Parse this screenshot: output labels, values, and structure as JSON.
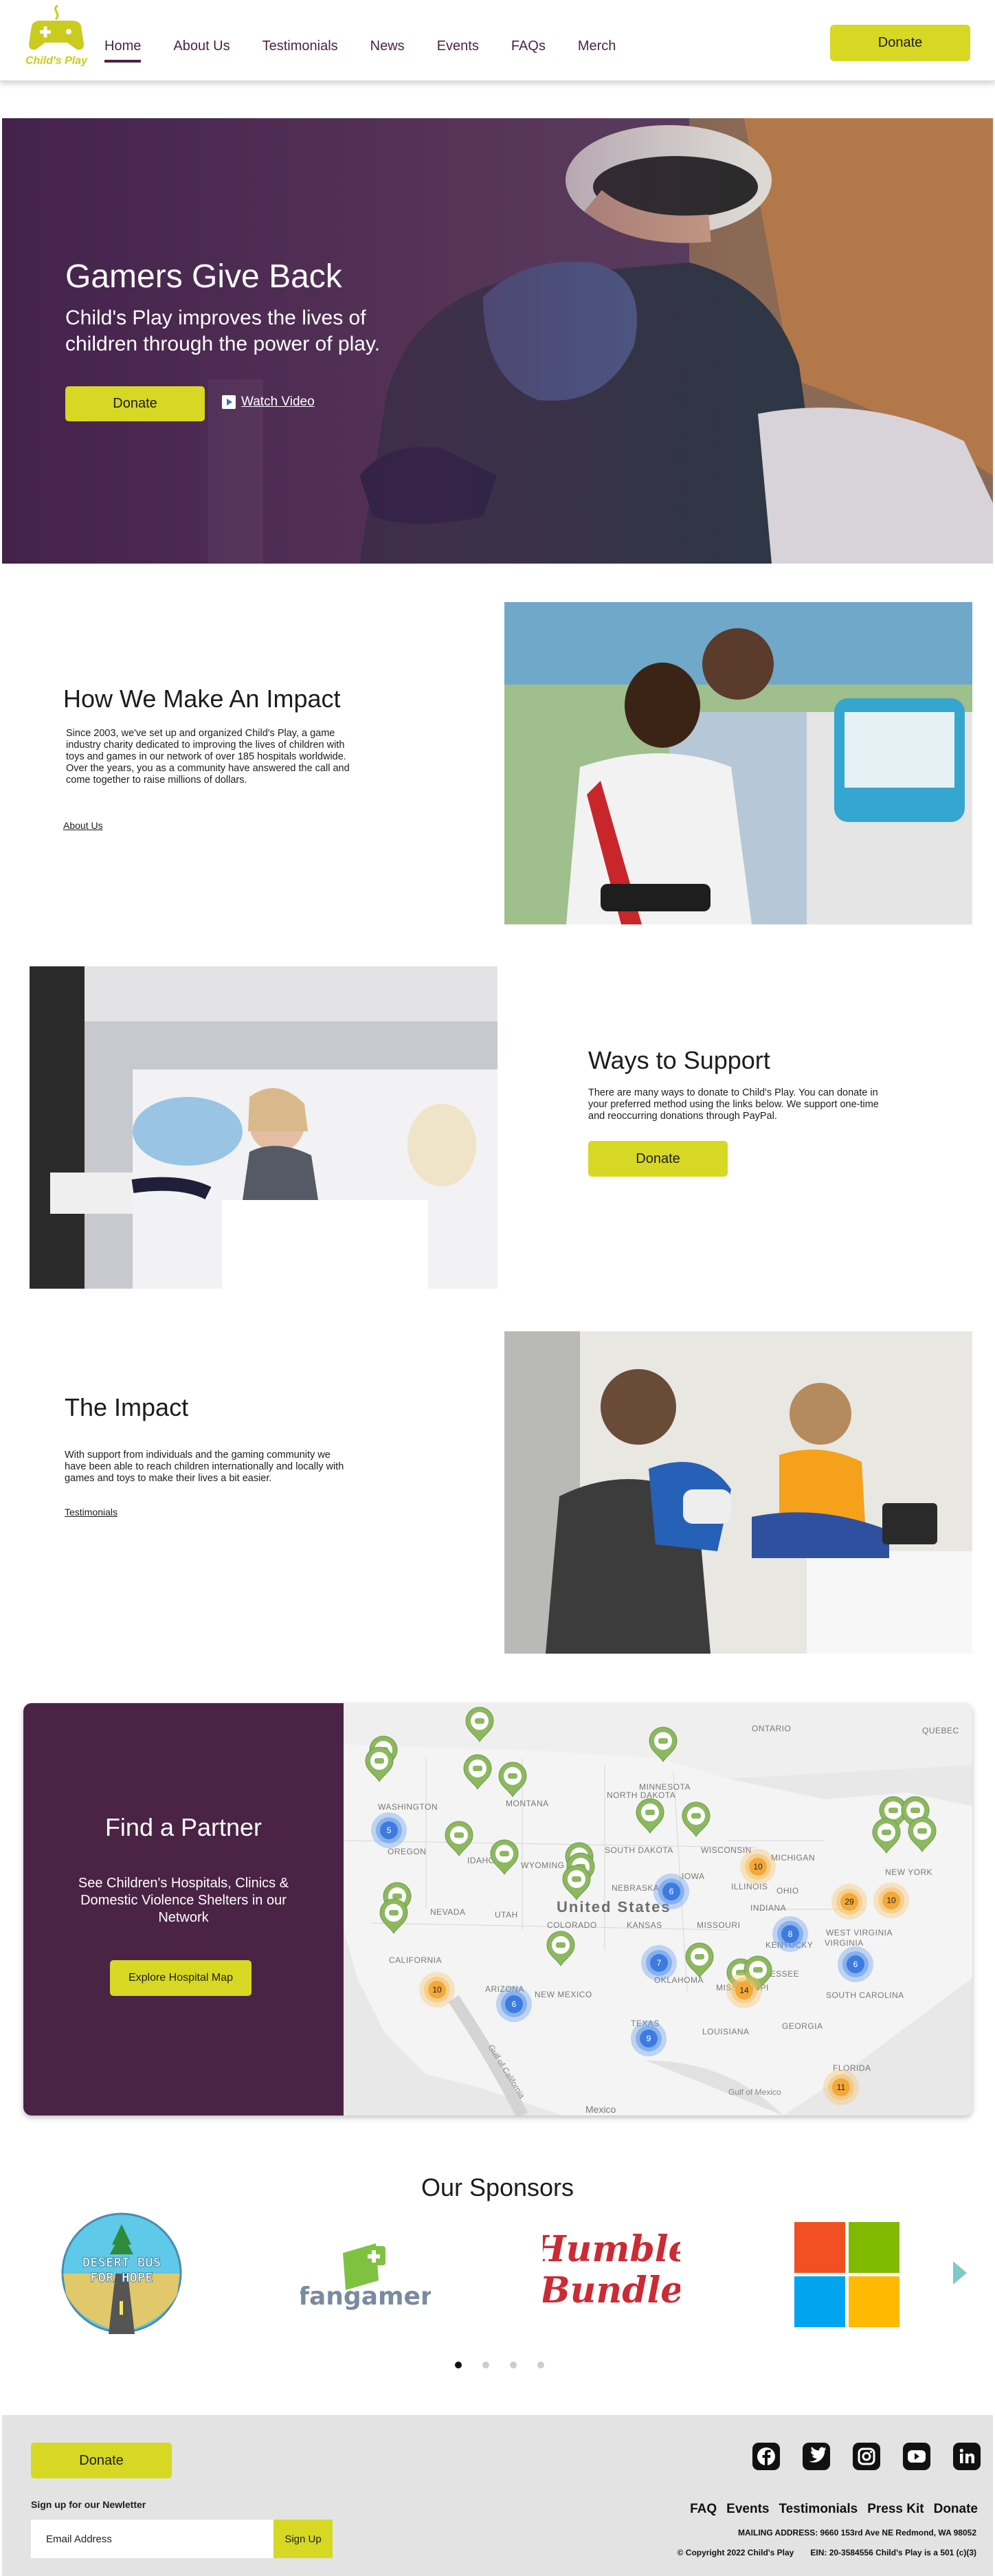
{
  "nav": {
    "logo_text": "Child's Play",
    "links": [
      "Home",
      "About Us",
      "Testimonials",
      "News",
      "Events",
      "FAQs",
      "Merch"
    ],
    "active": "Home",
    "donate_label": "Donate"
  },
  "hero": {
    "title": "Gamers Give Back",
    "subtitle": "Child's Play improves the lives of children through the power of play.",
    "donate_label": "Donate",
    "watch_label": "Watch Video"
  },
  "impact_intro": {
    "title": "How We Make An Impact",
    "body": "Since 2003, we've set up and organized Child's Play, a game industry charity dedicated to improving the lives of children with toys and games in our network of over 185 hospitals worldwide. Over the years, you as a community have answered the call and come together to raise millions of dollars.",
    "link": "About Us"
  },
  "support": {
    "title": "Ways to Support",
    "body": "There are many ways to donate to Child's Play. You can donate in your preferred method using the links below. We support one-time and reoccurring donations through PayPal.",
    "button": "Donate"
  },
  "the_impact": {
    "title": "The Impact",
    "body": "With support from individuals and the gaming community we have been able to reach children internationally and locally with games and toys to make their lives a bit easier.",
    "link": "Testimonials"
  },
  "partner": {
    "title": "Find a Partner",
    "subtitle": "See Children's Hospitals, Clinics & Domestic Violence Shelters in our Network",
    "button": "Explore Hospital Map",
    "map_labels": {
      "country": "United States",
      "mexico": "Mexico",
      "gulf_ca": "Gulf of California",
      "gulf_mx": "Gulf of Mexico",
      "states": [
        "WASHINGTON",
        "OREGON",
        "IDAHO",
        "MONTANA",
        "WYOMING",
        "NEVADA",
        "CALIFORNIA",
        "UTAH",
        "ARIZONA",
        "NEW MEXICO",
        "COLORADO",
        "NORTH DAKOTA",
        "SOUTH DAKOTA",
        "NEBRASKA",
        "KANSAS",
        "OKLAHOMA",
        "TEXAS",
        "MINNESOTA",
        "IOWA",
        "MISSOURI",
        "WISCONSIN",
        "ILLINOIS",
        "MICHIGAN",
        "INDIANA",
        "OHIO",
        "KENTUCKY",
        "TENNESSEE",
        "MISSISSIPPI",
        "LOUISIANA",
        "GEORGIA",
        "FLORIDA",
        "WEST VIRGINIA",
        "VIRGINIA",
        "SOUTH CAROLINA",
        "ONTARIO",
        "QUEBEC",
        "NEW YORK"
      ],
      "clusters_blue": [
        "5",
        "6",
        "7",
        "6",
        "9",
        "8",
        "6"
      ],
      "clusters_orange": [
        "10",
        "10",
        "14",
        "29",
        "10",
        "11"
      ]
    }
  },
  "sponsors": {
    "title": "Our Sponsors",
    "items": [
      {
        "name": "Desert Bus For Hope",
        "line1": "DESERT BUS",
        "line2": "FOR HOPE"
      },
      {
        "name": "Fangamer",
        "text": "fangamer"
      },
      {
        "name": "Humble Bundle",
        "line1": "Humble",
        "line2": "Bundle"
      },
      {
        "name": "Microsoft"
      }
    ],
    "page_count": 4,
    "active_page": 1
  },
  "footer": {
    "donate_label": "Donate",
    "newsletter_label": "Sign up for our Newletter",
    "email_placeholder": "Email Address",
    "signup_label": "Sign Up",
    "social": [
      "facebook-icon",
      "twitter-icon",
      "instagram-icon",
      "youtube-icon",
      "linkedin-icon"
    ],
    "links": [
      "FAQ",
      "Events",
      "Testimonials",
      "Press Kit",
      "Donate"
    ],
    "address": "MAILING ADDRESS: 9660 153rd Ave NE Redmond, WA 98052",
    "copyright": "© Copyright 2022 Child's Play",
    "ein": "EIN: 20-3584556 Child's Play is a 501 (c)(3)"
  },
  "colors": {
    "accent": "#d6d824",
    "brand": "#4a2345",
    "footer_bg": "#e3e3e3"
  }
}
